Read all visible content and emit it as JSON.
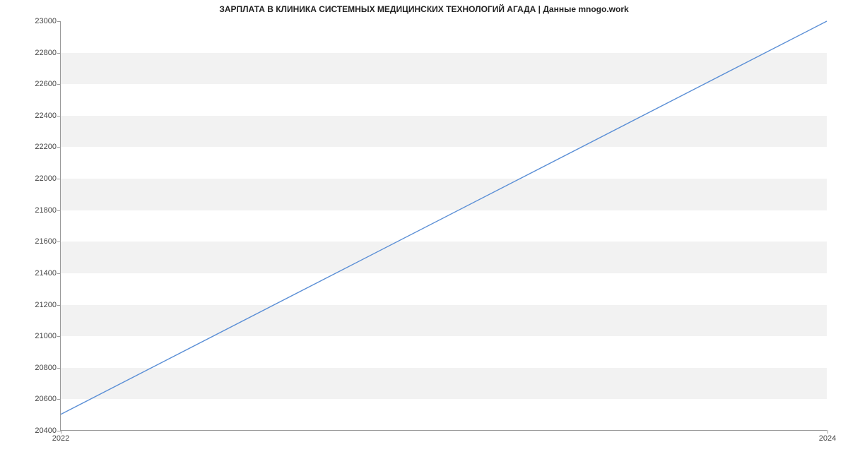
{
  "chart_data": {
    "type": "line",
    "title": "ЗАРПЛАТА В  КЛИНИКА СИСТЕМНЫХ МЕДИЦИНСКИХ ТЕХНОЛОГИЙ АГАДА | Данные mnogo.work",
    "x": [
      2022,
      2024
    ],
    "values": [
      20500,
      23000
    ],
    "xlabel": "",
    "ylabel": "",
    "xlim": [
      2022,
      2024
    ],
    "ylim": [
      20400,
      23000
    ],
    "x_ticks": [
      2022,
      2024
    ],
    "y_ticks": [
      20400,
      20600,
      20800,
      21000,
      21200,
      21400,
      21600,
      21800,
      22000,
      22200,
      22400,
      22600,
      22800,
      23000
    ],
    "line_color": "#5b8fd6",
    "band_color": "#f2f2f2"
  }
}
